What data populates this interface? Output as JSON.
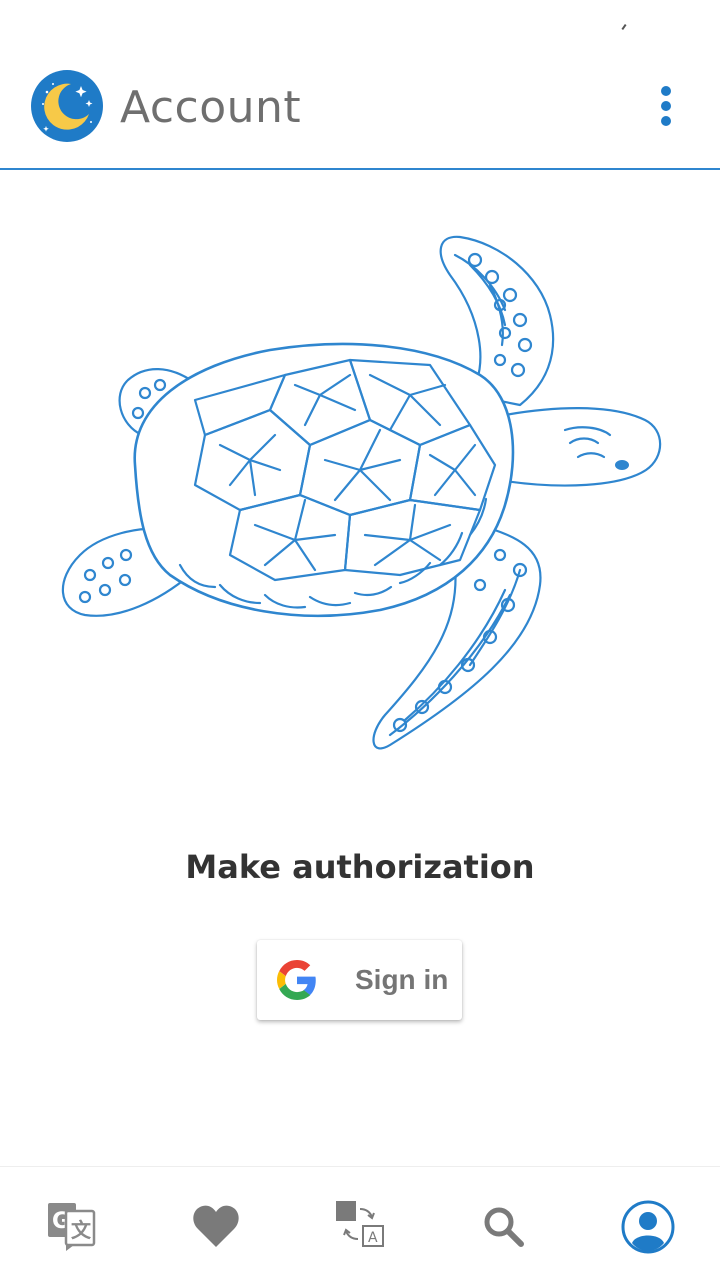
{
  "app_bar": {
    "title": "Account",
    "logo_icon": "moon-stars-icon",
    "menu_icon": "more-vert-icon"
  },
  "main": {
    "illustration": "sea-turtle",
    "prompt": "Make authorization",
    "sign_in_button": {
      "icon": "google-g-icon",
      "label": "Sign in"
    }
  },
  "bottom_nav": {
    "items": [
      {
        "icon": "google-translate-icon",
        "active": false
      },
      {
        "icon": "heart-icon",
        "active": false
      },
      {
        "icon": "translate-swap-icon",
        "active": false
      },
      {
        "icon": "search-icon",
        "active": false
      },
      {
        "icon": "account-icon",
        "active": true
      }
    ]
  },
  "colors": {
    "accent": "#2f86cf",
    "logo_circle": "#1f7bc7",
    "moon": "#f7c948",
    "inactive_icon": "#7a7a7a",
    "active_icon": "#1f7bc7",
    "text_dark": "#333333",
    "title_gray": "#6f6f6f"
  }
}
